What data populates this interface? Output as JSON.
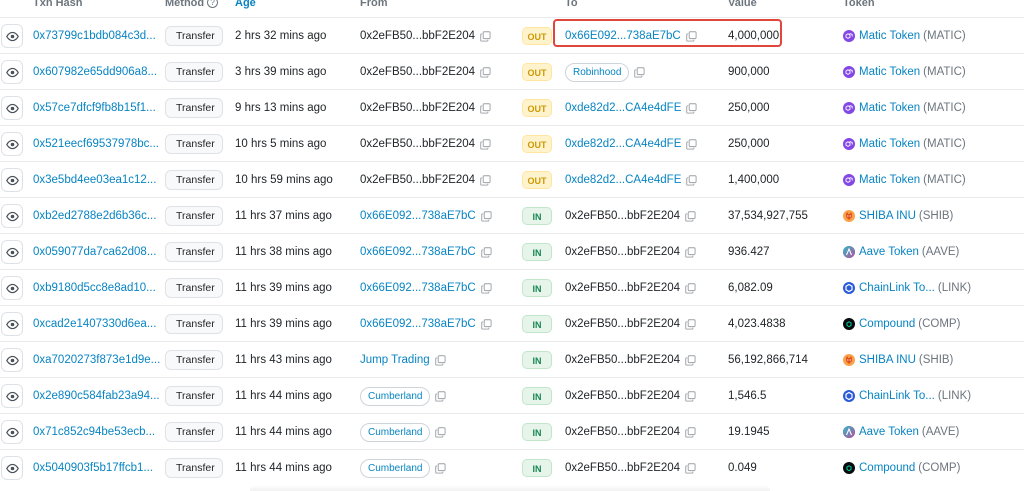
{
  "header": {
    "txn_hash": "Txn Hash",
    "method": "Method",
    "age": "Age",
    "from": "From",
    "to": "To",
    "value": "Value",
    "token": "Token"
  },
  "rows": [
    {
      "hash": "0x73799c1bdb084c3d...",
      "method": "Transfer",
      "age": "2 hrs 32 mins ago",
      "from": "0x2eFB50...bbF2E204",
      "from_type": "addr-plain",
      "dir": "OUT",
      "to": "0x66E092...738aE7bC",
      "to_type": "addr-link",
      "value": "4,000,000",
      "token_name": "Matic Token",
      "token_sym": "(MATIC)",
      "token_icon": "matic-icon"
    },
    {
      "hash": "0x607982e65dd906a8...",
      "method": "Transfer",
      "age": "3 hrs 39 mins ago",
      "from": "0x2eFB50...bbF2E204",
      "from_type": "addr-plain",
      "dir": "OUT",
      "to": "Robinhood",
      "to_type": "pill",
      "value": "900,000",
      "token_name": "Matic Token",
      "token_sym": "(MATIC)",
      "token_icon": "matic-icon"
    },
    {
      "hash": "0x57ce7dfcf9fb8b15f1...",
      "method": "Transfer",
      "age": "9 hrs 13 mins ago",
      "from": "0x2eFB50...bbF2E204",
      "from_type": "addr-plain",
      "dir": "OUT",
      "to": "0xde82d2...CA4e4dFE",
      "to_type": "addr-link",
      "value": "250,000",
      "token_name": "Matic Token",
      "token_sym": "(MATIC)",
      "token_icon": "matic-icon"
    },
    {
      "hash": "0x521eecf69537978bc...",
      "method": "Transfer",
      "age": "10 hrs 5 mins ago",
      "from": "0x2eFB50...bbF2E204",
      "from_type": "addr-plain",
      "dir": "OUT",
      "to": "0xde82d2...CA4e4dFE",
      "to_type": "addr-link",
      "value": "250,000",
      "token_name": "Matic Token",
      "token_sym": "(MATIC)",
      "token_icon": "matic-icon"
    },
    {
      "hash": "0x3e5bd4ee03ea1c12...",
      "method": "Transfer",
      "age": "10 hrs 59 mins ago",
      "from": "0x2eFB50...bbF2E204",
      "from_type": "addr-plain",
      "dir": "OUT",
      "to": "0xde82d2...CA4e4dFE",
      "to_type": "addr-link",
      "value": "1,400,000",
      "token_name": "Matic Token",
      "token_sym": "(MATIC)",
      "token_icon": "matic-icon"
    },
    {
      "hash": "0xb2ed2788e2d6b36c...",
      "method": "Transfer",
      "age": "11 hrs 37 mins ago",
      "from": "0x66E092...738aE7bC",
      "from_type": "addr-link",
      "dir": "IN",
      "to": "0x2eFB50...bbF2E204",
      "to_type": "addr-plain",
      "value": "37,534,927,755",
      "token_name": "SHIBA INU",
      "token_sym": "(SHIB)",
      "token_icon": "shiba-icon"
    },
    {
      "hash": "0x059077da7ca62d08...",
      "method": "Transfer",
      "age": "11 hrs 38 mins ago",
      "from": "0x66E092...738aE7bC",
      "from_type": "addr-link",
      "dir": "IN",
      "to": "0x2eFB50...bbF2E204",
      "to_type": "addr-plain",
      "value": "936.427",
      "token_name": "Aave Token",
      "token_sym": "(AAVE)",
      "token_icon": "aave-icon"
    },
    {
      "hash": "0xb9180d5cc8e8ad10...",
      "method": "Transfer",
      "age": "11 hrs 39 mins ago",
      "from": "0x66E092...738aE7bC",
      "from_type": "addr-link",
      "dir": "IN",
      "to": "0x2eFB50...bbF2E204",
      "to_type": "addr-plain",
      "value": "6,082.09",
      "token_name": "ChainLink To...",
      "token_sym": "(LINK)",
      "token_icon": "chainlink-icon"
    },
    {
      "hash": "0xcad2e1407330d6ea...",
      "method": "Transfer",
      "age": "11 hrs 39 mins ago",
      "from": "0x66E092...738aE7bC",
      "from_type": "addr-link",
      "dir": "IN",
      "to": "0x2eFB50...bbF2E204",
      "to_type": "addr-plain",
      "value": "4,023.4838",
      "token_name": "Compound",
      "token_sym": "(COMP)",
      "token_icon": "compound-icon"
    },
    {
      "hash": "0xa7020273f873e1d9e...",
      "method": "Transfer",
      "age": "11 hrs 43 mins ago",
      "from": "Jump Trading",
      "from_type": "name-link",
      "dir": "IN",
      "to": "0x2eFB50...bbF2E204",
      "to_type": "addr-plain",
      "value": "56,192,866,714",
      "token_name": "SHIBA INU",
      "token_sym": "(SHIB)",
      "token_icon": "shiba-icon"
    },
    {
      "hash": "0x2e890c584fab23a94...",
      "method": "Transfer",
      "age": "11 hrs 44 mins ago",
      "from": "Cumberland",
      "from_type": "pill",
      "dir": "IN",
      "to": "0x2eFB50...bbF2E204",
      "to_type": "addr-plain",
      "value": "1,546.5",
      "token_name": "ChainLink To...",
      "token_sym": "(LINK)",
      "token_icon": "chainlink-icon"
    },
    {
      "hash": "0x71c852c94be53ecb...",
      "method": "Transfer",
      "age": "11 hrs 44 mins ago",
      "from": "Cumberland",
      "from_type": "pill",
      "dir": "IN",
      "to": "0x2eFB50...bbF2E204",
      "to_type": "addr-plain",
      "value": "19.1945",
      "token_name": "Aave Token",
      "token_sym": "(AAVE)",
      "token_icon": "aave-icon"
    },
    {
      "hash": "0x5040903f5b17ffcb1...",
      "method": "Transfer",
      "age": "11 hrs 44 mins ago",
      "from": "Cumberland",
      "from_type": "pill",
      "dir": "IN",
      "to": "0x2eFB50...bbF2E204",
      "to_type": "addr-plain",
      "value": "0.049",
      "token_name": "Compound",
      "token_sym": "(COMP)",
      "token_icon": "compound-icon"
    }
  ],
  "colors": {
    "link": "#0784c3",
    "out_badge": "#cc9a06",
    "in_badge": "#198754",
    "highlight": "#e0473c"
  }
}
